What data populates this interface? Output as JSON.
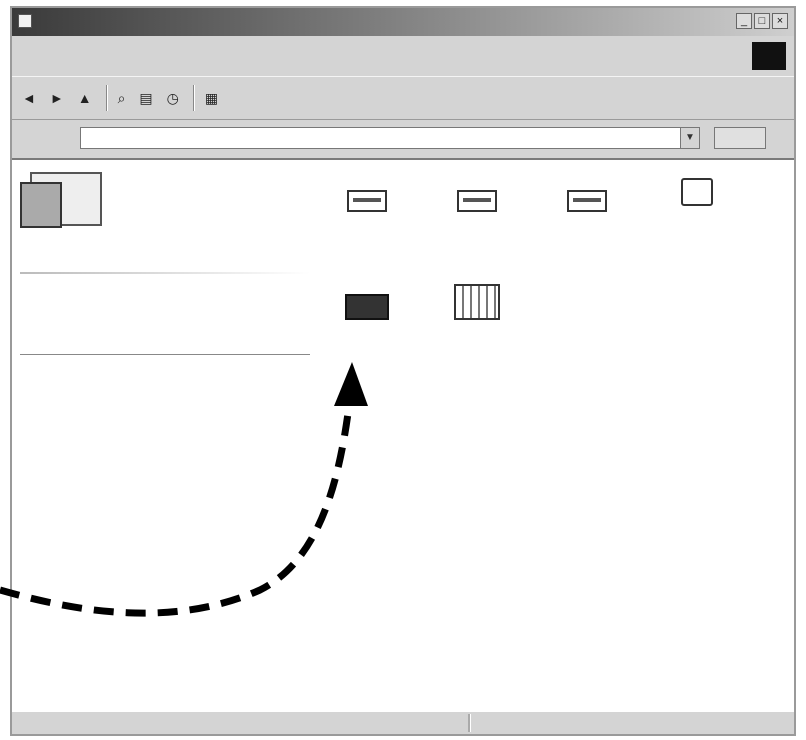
{
  "window": {
    "title": "",
    "buttons": [
      "_",
      "□",
      "×"
    ],
    "menu": [
      "",
      "",
      "",
      "",
      "",
      "",
      ""
    ],
    "logo": ""
  },
  "toolbar": {
    "items": [
      {
        "label": "",
        "icon": "back-arrow-icon"
      },
      {
        "label": "",
        "icon": "forward-arrow-icon"
      },
      {
        "label": "",
        "icon": "up-folder-icon"
      },
      {
        "label": "",
        "icon": "search-icon"
      },
      {
        "label": "",
        "icon": "folders-icon"
      },
      {
        "label": "",
        "icon": "history-icon"
      },
      {
        "label": "",
        "icon": "views-icon"
      }
    ]
  },
  "address": {
    "label": "",
    "value": "",
    "go": ""
  },
  "leftpane": {
    "title": "",
    "subtitle": "",
    "description": "",
    "link": "",
    "info": ""
  },
  "files": [
    {
      "name": "",
      "sub": "",
      "icon": "drive-icon"
    },
    {
      "name": "",
      "sub": "",
      "icon": "drive-icon"
    },
    {
      "name": "",
      "sub": "",
      "icon": "drive-icon"
    },
    {
      "name": "",
      "sub": "",
      "icon": "printer-icon"
    },
    {
      "name": "",
      "sub": "",
      "icon": "control-panel-icon"
    },
    {
      "name": "",
      "sub": "",
      "icon": "scheduled-tasks-icon"
    }
  ],
  "status": {
    "left": "",
    "right": ""
  },
  "annotation": {
    "arrow": "dashed-curved-arrow-icon",
    "color": "#000000"
  }
}
